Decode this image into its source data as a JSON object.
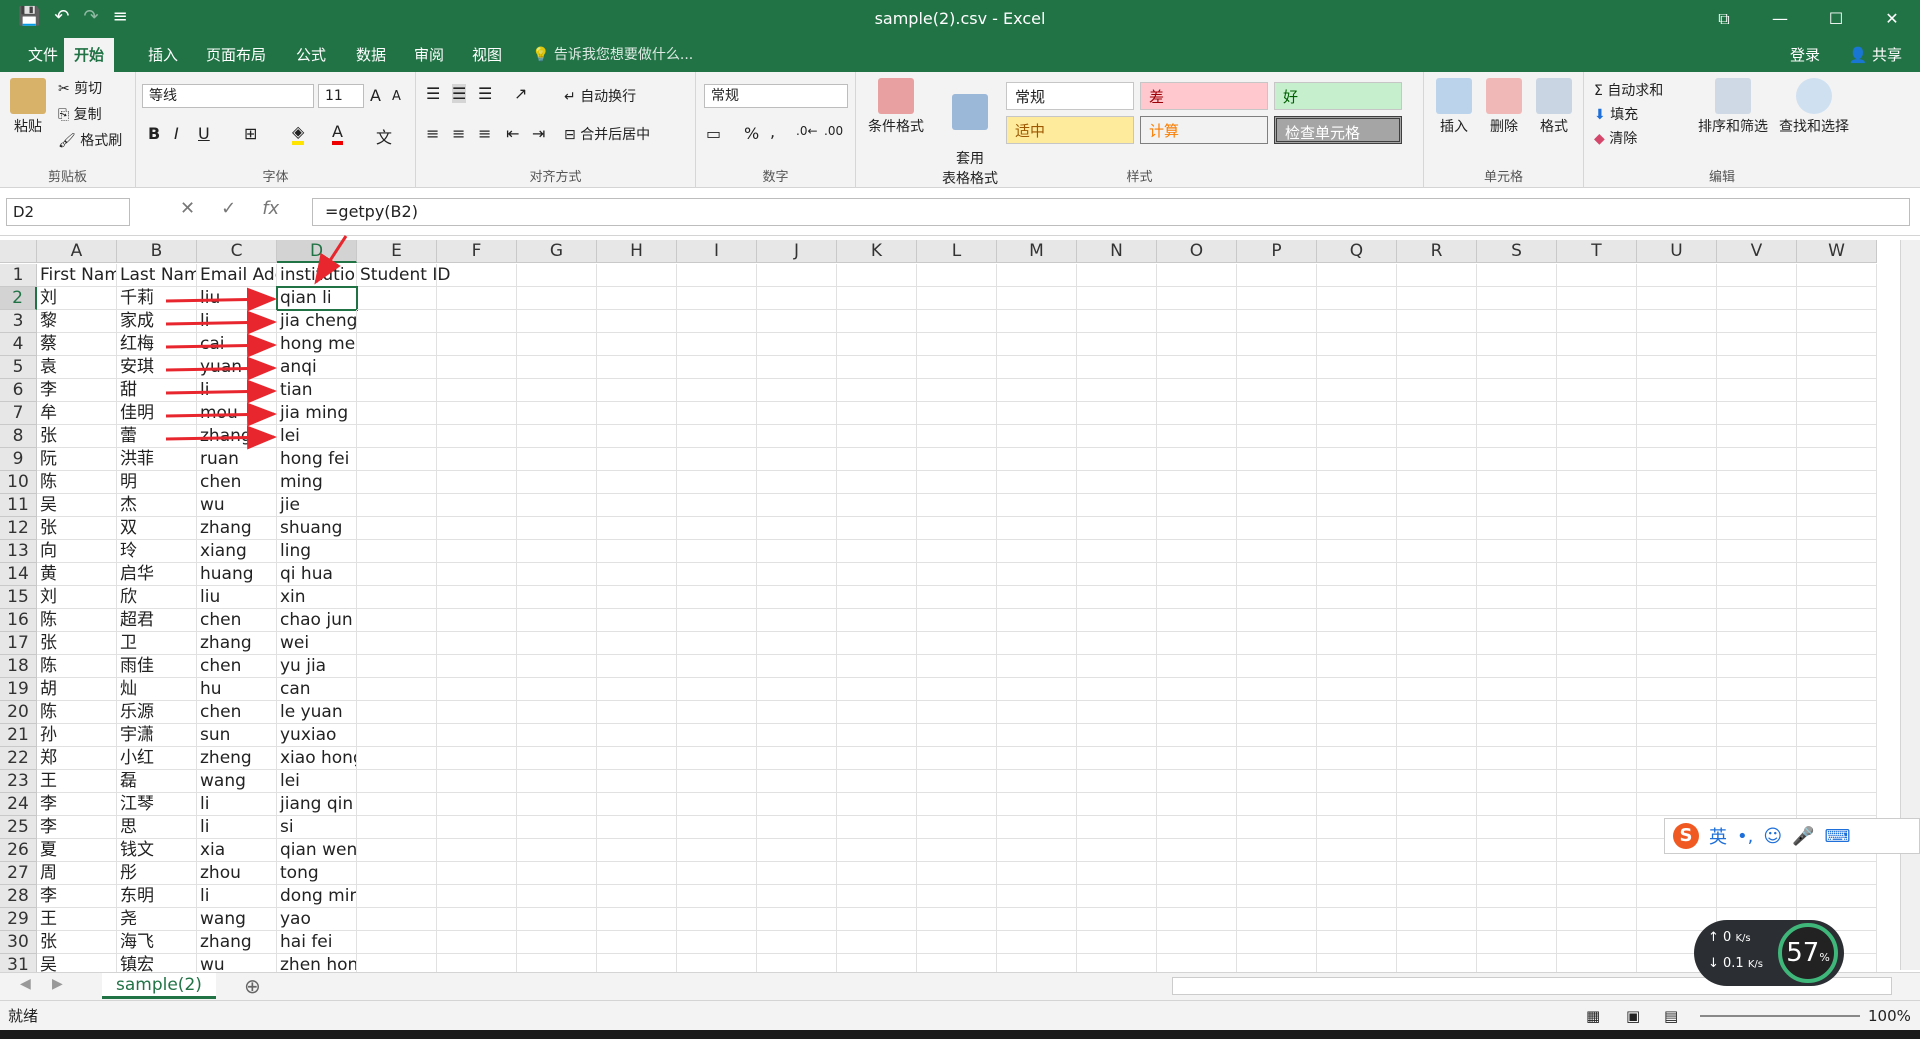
{
  "window": {
    "title": "sample(2).csv - Excel"
  },
  "qat": {
    "save": "💾",
    "undo": "↶",
    "redo": "↷",
    "more": "≡"
  },
  "winbtns": {
    "restore": "⧉",
    "minimize": "—",
    "maximize": "☐",
    "close": "✕"
  },
  "tabs": [
    "文件",
    "开始",
    "插入",
    "页面布局",
    "公式",
    "数据",
    "审阅",
    "视图"
  ],
  "tellme": "告诉我您想要做什么...",
  "account": {
    "login": "登录",
    "share": "共享"
  },
  "ribbon": {
    "clipboard": {
      "paste": "粘贴",
      "cut": "剪切",
      "copy": "复制",
      "painter": "格式刷",
      "label": "剪贴板"
    },
    "font": {
      "name": "等线",
      "size": "11",
      "bold": "B",
      "italic": "I",
      "underline": "U",
      "label": "字体",
      "grow": "A",
      "shrink": "A"
    },
    "align": {
      "wrap": "自动换行",
      "merge": "合并后居中",
      "label": "对齐方式"
    },
    "number": {
      "format": "常规",
      "percent": "%",
      "comma": ",",
      "label": "数字"
    },
    "styles": {
      "cond": "条件格式",
      "table": "套用\n表格格式",
      "normal": "常规",
      "bad": "差",
      "good": "好",
      "neutral": "适中",
      "calc": "计算",
      "check": "检查单元格",
      "label": "样式"
    },
    "cells": {
      "insert": "插入",
      "delete": "删除",
      "format": "格式",
      "label": "单元格"
    },
    "edit": {
      "autosum": "自动求和",
      "fill": "填充",
      "clear": "清除",
      "sort": "排序和筛选",
      "find": "查找和选择",
      "label": "编辑"
    }
  },
  "formula_bar": {
    "name_box": "D2",
    "fx": "fx",
    "cancel": "✕",
    "enter": "✓",
    "formula": "=getpy(B2)"
  },
  "columns": [
    "A",
    "B",
    "C",
    "D",
    "E",
    "F",
    "G",
    "H",
    "I",
    "J",
    "K",
    "L",
    "M",
    "N",
    "O",
    "P",
    "Q",
    "R",
    "S",
    "T",
    "U",
    "V",
    "W"
  ],
  "header_row": [
    "First Name",
    "Last Name",
    "Email Address",
    "institution",
    "Student ID"
  ],
  "rows": [
    [
      "刘",
      "千莉",
      "liu",
      "qian li"
    ],
    [
      "黎",
      "家成",
      "li",
      "jia cheng"
    ],
    [
      "蔡",
      "红梅",
      "cai",
      "hong mei"
    ],
    [
      "袁",
      "安琪",
      "yuan",
      "anqi"
    ],
    [
      "李",
      "甜",
      "li",
      "tian"
    ],
    [
      "牟",
      "佳明",
      "mou",
      "jia ming"
    ],
    [
      "张",
      "蕾",
      "zhang",
      "lei"
    ],
    [
      "阮",
      "洪菲",
      "ruan",
      "hong fei"
    ],
    [
      "陈",
      "明",
      "chen",
      "ming"
    ],
    [
      "吴",
      "杰",
      "wu",
      "jie"
    ],
    [
      "张",
      "双",
      "zhang",
      "shuang"
    ],
    [
      "向",
      "玲",
      "xiang",
      "ling"
    ],
    [
      "黄",
      "启华",
      "huang",
      "qi hua"
    ],
    [
      "刘",
      "欣",
      "liu",
      "xin"
    ],
    [
      "陈",
      "超君",
      "chen",
      "chao jun"
    ],
    [
      "张",
      "卫",
      "zhang",
      "wei"
    ],
    [
      "陈",
      "雨佳",
      "chen",
      "yu jia"
    ],
    [
      "胡",
      "灿",
      "hu",
      "can"
    ],
    [
      "陈",
      "乐源",
      "chen",
      "le yuan"
    ],
    [
      "孙",
      "宇潇",
      "sun",
      "yuxiao"
    ],
    [
      "郑",
      "小红",
      "zheng",
      "xiao hong"
    ],
    [
      "王",
      "磊",
      "wang",
      "lei"
    ],
    [
      "李",
      "江琴",
      "li",
      "jiang qin"
    ],
    [
      "李",
      "思",
      "li",
      "si"
    ],
    [
      "夏",
      "钱文",
      "xia",
      "qian wen"
    ],
    [
      "周",
      "彤",
      "zhou",
      "tong"
    ],
    [
      "李",
      "东明",
      "li",
      "dong ming"
    ],
    [
      "王",
      "尧",
      "wang",
      "yao"
    ],
    [
      "张",
      "海飞",
      "zhang",
      "hai fei"
    ],
    [
      "吴",
      "镇宏",
      "wu",
      "zhen hong"
    ]
  ],
  "sheet": {
    "tab": "sample(2)",
    "add": "⊕"
  },
  "status": {
    "ready": "就绪",
    "zoom": "100%"
  },
  "ime": {
    "logo": "S",
    "lang": "英",
    "punct": "•,",
    "emoji": "☺",
    "mic": "🎤",
    "kbd": "⌨"
  },
  "net": {
    "up": "0",
    "up_unit": "K/s",
    "down": "0.1",
    "down_unit": "K/s",
    "percent": "57"
  }
}
